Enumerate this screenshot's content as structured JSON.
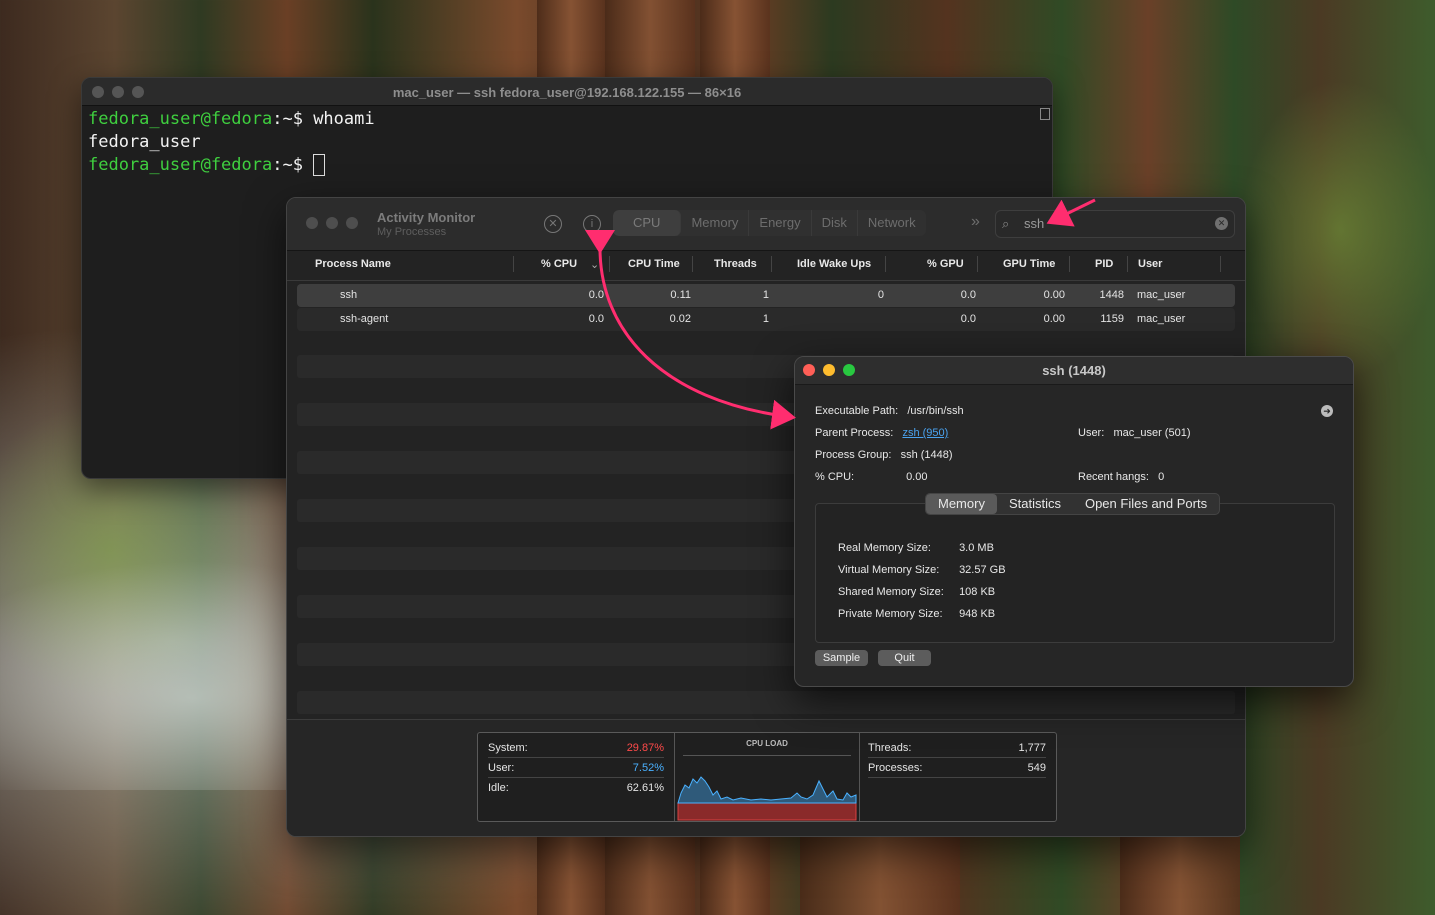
{
  "terminal": {
    "title": "mac_user — ssh fedora_user@192.168.122.155 — 86×16",
    "lines": [
      {
        "prompt": "fedora_user@fedora",
        "sep": ":~$",
        "cmd": " whoami"
      },
      {
        "output": "fedora_user"
      },
      {
        "prompt": "fedora_user@fedora",
        "sep": ":~$",
        "cmd": " "
      }
    ]
  },
  "activity_monitor": {
    "title": "Activity Monitor",
    "subtitle": "My Processes",
    "tabs": [
      "CPU",
      "Memory",
      "Energy",
      "Disk",
      "Network"
    ],
    "active_tab": "CPU",
    "search_value": "ssh",
    "columns": [
      "Process Name",
      "% CPU",
      "CPU Time",
      "Threads",
      "Idle Wake Ups",
      "% GPU",
      "GPU Time",
      "PID",
      "User"
    ],
    "rows": [
      {
        "name": "ssh",
        "cpu": "0.0",
        "cpu_time": "0.11",
        "threads": "1",
        "idle_wake": "0",
        "gpu": "0.0",
        "gpu_time": "0.00",
        "pid": "1448",
        "user": "mac_user"
      },
      {
        "name": "ssh-agent",
        "cpu": "0.0",
        "cpu_time": "0.02",
        "threads": "1",
        "idle_wake": "",
        "gpu": "0.0",
        "gpu_time": "0.00",
        "pid": "1159",
        "user": "mac_user"
      }
    ],
    "footer": {
      "system_label": "System:",
      "system_value": "29.87%",
      "user_label": "User:",
      "user_value": "7.52%",
      "idle_label": "Idle:",
      "idle_value": "62.61%",
      "cpu_load_label": "CPU LOAD",
      "threads_label": "Threads:",
      "threads_value": "1,777",
      "processes_label": "Processes:",
      "processes_value": "549"
    }
  },
  "inspector": {
    "title": "ssh (1448)",
    "executable_path_label": "Executable Path:",
    "executable_path": "/usr/bin/ssh",
    "parent_process_label": "Parent Process:",
    "parent_process": "zsh (950)",
    "user_label": "User:",
    "user": "mac_user (501)",
    "process_group_label": "Process Group:",
    "process_group": "ssh (1448)",
    "cpu_label": "% CPU:",
    "cpu": "0.00",
    "recent_hangs_label": "Recent hangs:",
    "recent_hangs": "0",
    "tabs": [
      "Memory",
      "Statistics",
      "Open Files and Ports"
    ],
    "active_tab": "Memory",
    "memory": [
      {
        "label": "Real Memory Size:",
        "value": "3.0 MB"
      },
      {
        "label": "Virtual Memory Size:",
        "value": "32.57 GB"
      },
      {
        "label": "Shared Memory Size:",
        "value": "108 KB"
      },
      {
        "label": "Private Memory Size:",
        "value": "948 KB"
      }
    ],
    "sample_button": "Sample",
    "quit_button": "Quit"
  },
  "colors": {
    "annotation_arrow": "#ff2d6f",
    "terminal_prompt": "#3fcf3f",
    "system_load": "#ff4a4a",
    "user_load": "#4ab1ff",
    "link": "#4aa3f0"
  }
}
